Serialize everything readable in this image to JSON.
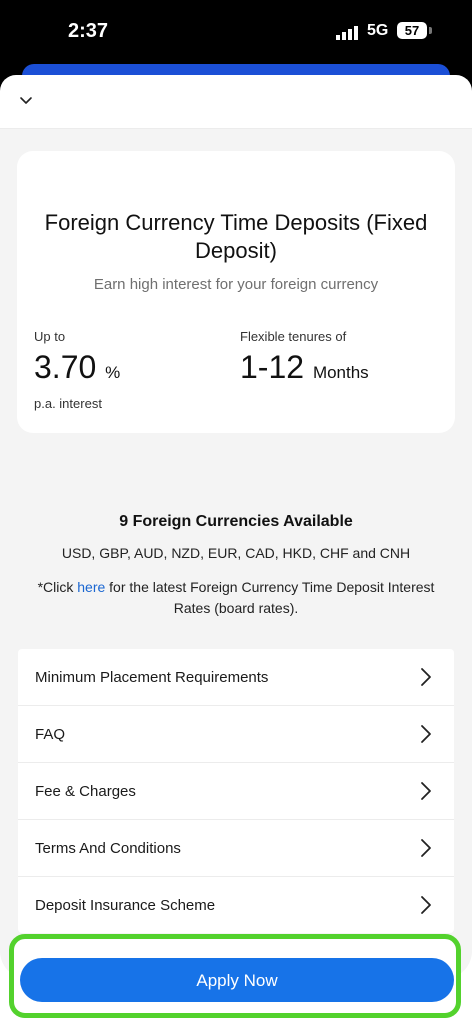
{
  "status_bar": {
    "time": "2:37",
    "network": "5G",
    "battery": "57"
  },
  "product": {
    "title": "Foreign Currency Time Deposits (Fixed Deposit)",
    "subtitle": "Earn high interest for your foreign currency",
    "rate": {
      "label": "Up to",
      "value": "3.70",
      "unit": "%",
      "note": "p.a. interest"
    },
    "tenure": {
      "label": "Flexible tenures of",
      "value": "1-12",
      "unit": "Months"
    }
  },
  "currencies": {
    "title": "9 Foreign Currencies Available",
    "list": "USD, GBP, AUD, NZD, EUR, CAD, HKD, CHF and CNH",
    "note_prefix": "*Click ",
    "note_link": "here",
    "note_suffix": " for the latest Foreign Currency Time Deposit Interest Rates (board rates)."
  },
  "menu": [
    {
      "label": "Minimum Placement Requirements"
    },
    {
      "label": "FAQ"
    },
    {
      "label": "Fee & Charges"
    },
    {
      "label": "Terms And Conditions"
    },
    {
      "label": "Deposit Insurance Scheme"
    }
  ],
  "apply_button": {
    "label": "Apply Now"
  },
  "colors": {
    "primary": "#1773e8",
    "highlight": "#53d22d",
    "panel": "#f4f4f4",
    "link": "#1a66d1"
  }
}
